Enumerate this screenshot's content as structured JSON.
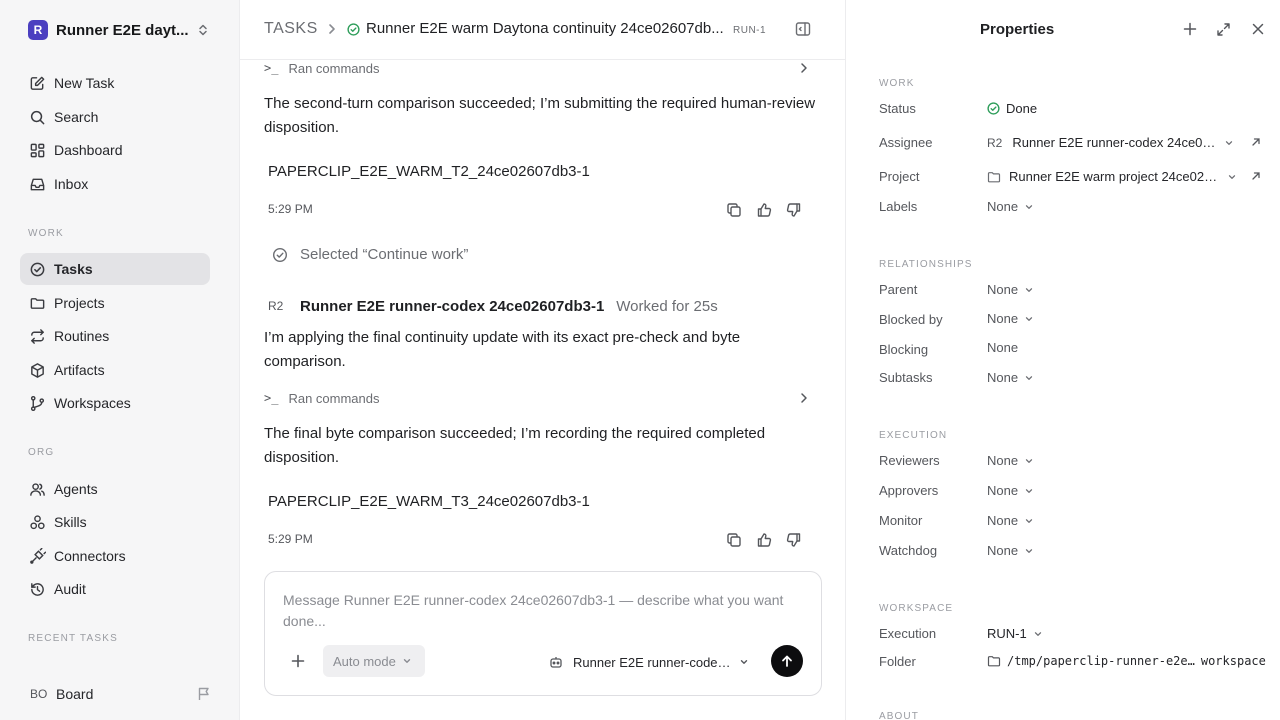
{
  "sidebar": {
    "workspace": {
      "logo": "R",
      "name": "Runner E2E dayt..."
    },
    "nav": [
      {
        "label": "New Task",
        "icon": "pencil-square-icon"
      },
      {
        "label": "Search",
        "icon": "search-icon"
      },
      {
        "label": "Dashboard",
        "icon": "dashboard-icon"
      },
      {
        "label": "Inbox",
        "icon": "inbox-icon"
      }
    ],
    "work_heading": "WORK",
    "work": [
      {
        "label": "Tasks",
        "icon": "check-circle-icon",
        "active": true
      },
      {
        "label": "Projects",
        "icon": "folder-icon"
      },
      {
        "label": "Routines",
        "icon": "repeat-icon"
      },
      {
        "label": "Artifacts",
        "icon": "cube-icon"
      },
      {
        "label": "Workspaces",
        "icon": "branch-icon"
      }
    ],
    "org_heading": "ORG",
    "org": [
      {
        "label": "Agents",
        "icon": "users-icon"
      },
      {
        "label": "Skills",
        "icon": "skills-icon"
      },
      {
        "label": "Connectors",
        "icon": "plug-icon"
      },
      {
        "label": "Audit",
        "icon": "history-icon"
      }
    ],
    "recent_heading": "RECENT TASKS",
    "board": {
      "badge": "BO",
      "label": "Board"
    }
  },
  "header": {
    "breadcrumb_root": "TASKS",
    "title": "Runner E2E warm Daytona continuity 24ce02607db...",
    "id": "RUN-1"
  },
  "thread": {
    "ran_commands_1": "Ran commands",
    "message_1": "The second-turn comparison succeeded; I’m submitting the required human-review disposition.",
    "token_1": "PAPERCLIP_E2E_WARM_T2_24ce02607db3-1",
    "time_1": "5:29 PM",
    "selected": "Selected “Continue work”",
    "agent_badge": "R2",
    "agent_name": "Runner E2E runner-codex 24ce02607db3-1",
    "agent_meta": "Worked for 25s",
    "message_2": "I’m applying the final continuity update with its exact pre-check and byte comparison.",
    "ran_commands_2": "Ran commands",
    "message_3": "The final byte comparison succeeded; I’m recording the required completed disposition.",
    "token_2": "PAPERCLIP_E2E_WARM_T3_24ce02607db3-1",
    "time_2": "5:29 PM"
  },
  "composer": {
    "placeholder": "Message Runner E2E runner-codex 24ce02607db3-1 — describe what you want done...",
    "mode": "Auto mode",
    "agent": "Runner E2E runner-codex..."
  },
  "properties": {
    "title": "Properties",
    "work_heading": "WORK",
    "status_label": "Status",
    "status_value": "Done",
    "assignee_label": "Assignee",
    "assignee_badge": "R2",
    "assignee_value": "Runner E2E runner-codex 24ce02...",
    "project_label": "Project",
    "project_value": "Runner E2E warm project 24ce026...",
    "labels_label": "Labels",
    "labels_value": "None",
    "relationships_heading": "RELATIONSHIPS",
    "parent_label": "Parent",
    "parent_value": "None",
    "blocked_by_label": "Blocked by",
    "blocked_by_value": "None",
    "blocking_label": "Blocking",
    "blocking_value": "None",
    "subtasks_label": "Subtasks",
    "subtasks_value": "None",
    "execution_heading": "EXECUTION",
    "reviewers_label": "Reviewers",
    "reviewers_value": "None",
    "approvers_label": "Approvers",
    "approvers_value": "None",
    "monitor_label": "Monitor",
    "monitor_value": "None",
    "watchdog_label": "Watchdog",
    "watchdog_value": "None",
    "workspace_heading": "WORKSPACE",
    "execution_label": "Execution",
    "execution_value": "RUN-1",
    "folder_label": "Folder",
    "folder_path": "/tmp/paperclip-runner-e2e…",
    "folder_suffix": "workspace",
    "about_heading": "ABOUT"
  },
  "colors": {
    "accent": "#4b3fc0",
    "done_green": "#2f9e5b",
    "active_bg": "#e3e3e6"
  }
}
